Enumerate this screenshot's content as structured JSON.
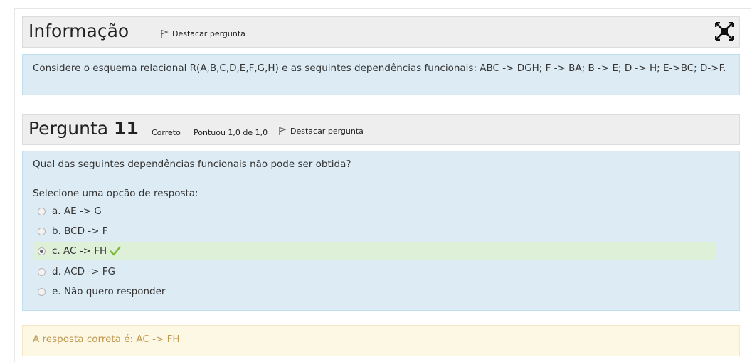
{
  "info": {
    "title": "Informação",
    "flag_label": "Destacar pergunta",
    "fullscreen_icon": "fullscreen-exit-icon",
    "text": "Considere o esquema relacional R(A,B,C,D,E,F,G,H) e as seguintes dependências funcionais: ABC -> DGH; F -> BA; B -> E; D -> H; E->BC; D->F."
  },
  "question": {
    "title_prefix": "Pergunta",
    "number": "11",
    "status": "Correto",
    "grade": "Pontuou 1,0 de 1,0",
    "flag_label": "Destacar pergunta",
    "prompt": "Qual das seguintes dependências funcionais não pode ser obtida?",
    "select_label": "Selecione uma opção de resposta:",
    "options": [
      {
        "label": "a. AE -> G",
        "selected": false
      },
      {
        "label": "b. BCD -> F",
        "selected": false
      },
      {
        "label": "c. AC -> FH",
        "selected": true,
        "correct": true
      },
      {
        "label": "d. ACD -> FG",
        "selected": false
      },
      {
        "label": "e. Não quero responder",
        "selected": false
      }
    ],
    "correct_answer_text": "A resposta correta é: AC -> FH"
  },
  "colors": {
    "header_bg": "#eeeeee",
    "formulation_bg": "#dcebf4",
    "selected_bg": "#dff0d8",
    "check_green": "#7cb93c",
    "feedback_bg": "#fcf8e3",
    "feedback_text": "#c09853"
  }
}
